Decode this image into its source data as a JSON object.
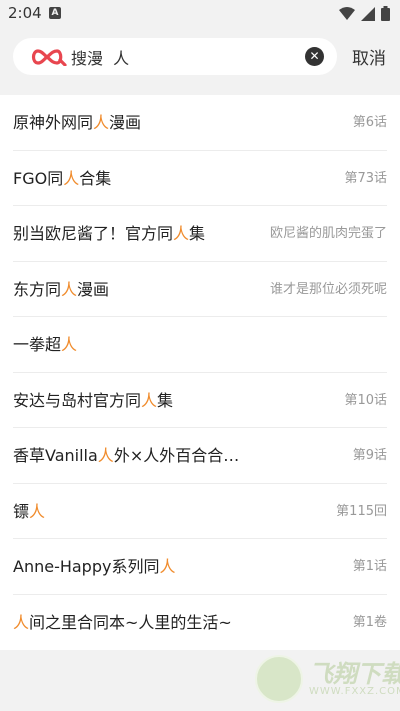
{
  "status_bar": {
    "time": "2:04",
    "notif": "A"
  },
  "search": {
    "query": "搜漫  人",
    "cancel_label": "取消"
  },
  "results": [
    {
      "pre": "原神外网同",
      "hl": "人",
      "post": "漫画",
      "sub": "第6话"
    },
    {
      "pre": "FGO同",
      "hl": "人",
      "post": "合集",
      "sub": "第73话"
    },
    {
      "pre": "别当欧尼酱了！官方同",
      "hl": "人",
      "post": "集",
      "sub": "欧尼酱的肌肉完蛋了"
    },
    {
      "pre": "东方同",
      "hl": "人",
      "post": "漫画",
      "sub": "谁才是那位必须死呢"
    },
    {
      "pre": "一拳超",
      "hl": "人",
      "post": "",
      "sub": ""
    },
    {
      "pre": "安达与岛村官方同",
      "hl": "人",
      "post": "集",
      "sub": "第10话"
    },
    {
      "pre": "香草Vanilla",
      "hl": "人",
      "post": "外×人外百合合…",
      "sub": "第9话"
    },
    {
      "pre": "镖",
      "hl": "人",
      "post": "",
      "sub": "第115回"
    },
    {
      "pre": "Anne-Happy系列同",
      "hl": "人",
      "post": "",
      "sub": "第1话"
    },
    {
      "pre": "",
      "hl": "人",
      "post": "间之里合同本~人里的生活~",
      "sub": "第1卷"
    }
  ],
  "watermark": {
    "main": "飞翔下载",
    "sub": "WWW.FXXZ.COM"
  },
  "colors": {
    "highlight": "#f08c2d",
    "logo": "#e8464f"
  }
}
